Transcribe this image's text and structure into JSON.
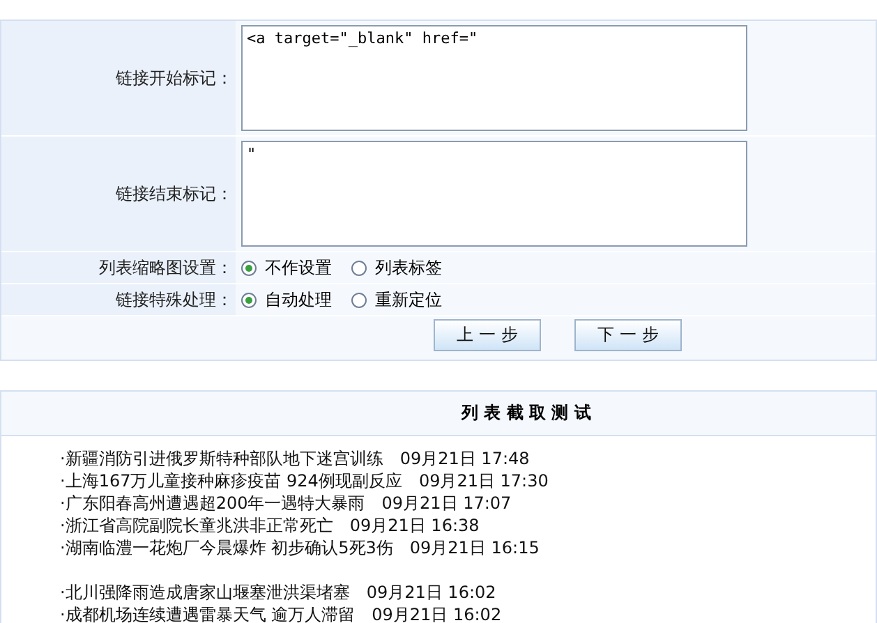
{
  "form": {
    "fields": [
      {
        "kind": "textarea",
        "label": "链接开始标记：",
        "value": "<a target=\"_blank\" href=\""
      },
      {
        "kind": "textarea",
        "label": "链接结束标记：",
        "value": "\""
      },
      {
        "kind": "radio",
        "label": "列表缩略图设置：",
        "options": [
          {
            "label": "不作设置",
            "selected": true
          },
          {
            "label": "列表标签",
            "selected": false
          }
        ]
      },
      {
        "kind": "radio",
        "label": "链接特殊处理：",
        "options": [
          {
            "label": "自动处理",
            "selected": true
          },
          {
            "label": "重新定位",
            "selected": false
          }
        ]
      }
    ],
    "buttons": [
      "上 一 步",
      "下 一 步"
    ]
  },
  "test_panel": {
    "title": "列 表 截 取 测 试",
    "groups": [
      [
        {
          "title": "·新疆消防引进俄罗斯特种部队地下迷宫训练",
          "time": "09月21日 17:48"
        },
        {
          "title": "·上海167万儿童接种麻疹疫苗 924例现副反应",
          "time": "09月21日 17:30"
        },
        {
          "title": "·广东阳春高州遭遇超200年一遇特大暴雨",
          "time": "09月21日 17:07"
        },
        {
          "title": "·浙江省高院副院长童兆洪非正常死亡",
          "time": "09月21日 16:38"
        },
        {
          "title": "·湖南临澧一花炮厂今晨爆炸 初步确认5死3伤",
          "time": "09月21日 16:15"
        }
      ],
      [
        {
          "title": "·北川强降雨造成唐家山堰塞泄洪渠堵塞",
          "time": "09月21日 16:02"
        },
        {
          "title": "·成都机场连续遭遇雷暴天气 逾万人滞留",
          "time": "09月21日 16:02"
        }
      ]
    ]
  }
}
